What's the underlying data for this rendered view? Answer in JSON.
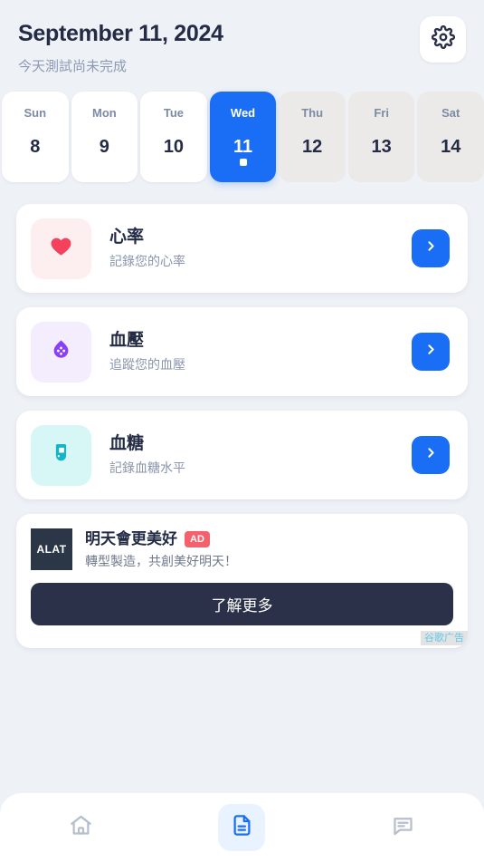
{
  "header": {
    "title": "September 11, 2024",
    "subtitle": "今天測試尚未完成",
    "settings_icon": "gear-icon"
  },
  "week": {
    "days": [
      {
        "name": "Sun",
        "num": "8",
        "state": "past"
      },
      {
        "name": "Mon",
        "num": "9",
        "state": "past"
      },
      {
        "name": "Tue",
        "num": "10",
        "state": "past"
      },
      {
        "name": "Wed",
        "num": "11",
        "state": "selected"
      },
      {
        "name": "Thu",
        "num": "12",
        "state": "future"
      },
      {
        "name": "Fri",
        "num": "13",
        "state": "future"
      },
      {
        "name": "Sat",
        "num": "14",
        "state": "future"
      }
    ]
  },
  "metrics": [
    {
      "title": "心率",
      "subtitle": "記錄您的心率",
      "icon": "heart-icon",
      "icon_color": "#f4415c",
      "icon_bg": "#fdeef0",
      "chevron": "chevron-right-icon"
    },
    {
      "title": "血壓",
      "subtitle": "追蹤您的血壓",
      "icon": "blood-pressure-drop-icon",
      "icon_color": "#8b3ef7",
      "icon_bg": "#f3edfd",
      "chevron": "chevron-right-icon"
    },
    {
      "title": "血糖",
      "subtitle": "記錄血糖水平",
      "icon": "glucose-meter-icon",
      "icon_color": "#14b5c4",
      "icon_bg": "#d7f7f6",
      "chevron": "chevron-right-icon"
    }
  ],
  "ad": {
    "logo_text": "ALAT",
    "title": "明天會更美好",
    "badge": "AD",
    "subtitle": "轉型製造，共創美好明天！",
    "cta_label": "了解更多",
    "attribution": "谷歌广告"
  },
  "bottom_nav": {
    "items": [
      {
        "icon": "home-icon",
        "active": false
      },
      {
        "icon": "document-icon",
        "active": true
      },
      {
        "icon": "chat-icon",
        "active": false
      }
    ]
  },
  "colors": {
    "accent_blue": "#1a6ef5",
    "background": "#eef1f6",
    "text_dark": "#232b45",
    "text_muted": "#8e9ab4",
    "ad_badge_red": "#f4606c",
    "cta_dark": "#2b3149"
  }
}
